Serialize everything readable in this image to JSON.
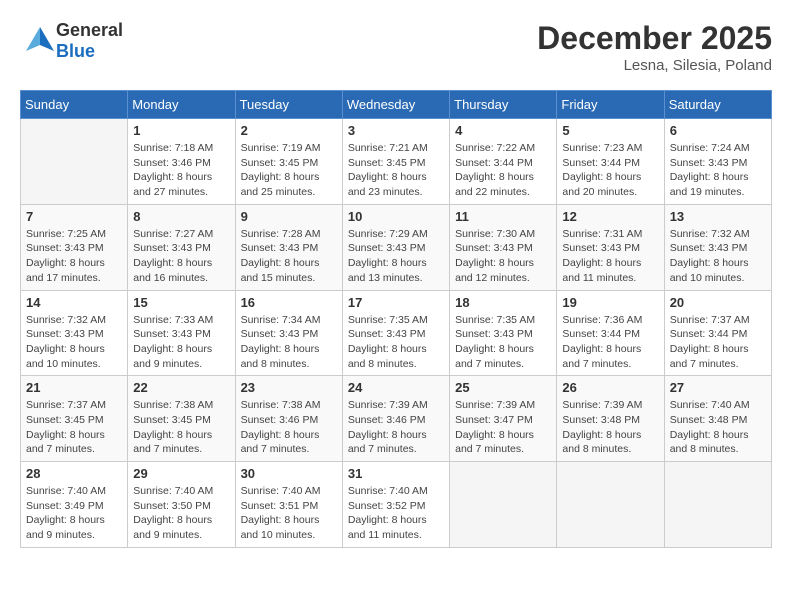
{
  "header": {
    "logo": {
      "text_general": "General",
      "text_blue": "Blue"
    },
    "month": "December 2025",
    "location": "Lesna, Silesia, Poland"
  },
  "days_of_week": [
    "Sunday",
    "Monday",
    "Tuesday",
    "Wednesday",
    "Thursday",
    "Friday",
    "Saturday"
  ],
  "weeks": [
    [
      {
        "day": "",
        "info": ""
      },
      {
        "day": "1",
        "info": "Sunrise: 7:18 AM\nSunset: 3:46 PM\nDaylight: 8 hours\nand 27 minutes."
      },
      {
        "day": "2",
        "info": "Sunrise: 7:19 AM\nSunset: 3:45 PM\nDaylight: 8 hours\nand 25 minutes."
      },
      {
        "day": "3",
        "info": "Sunrise: 7:21 AM\nSunset: 3:45 PM\nDaylight: 8 hours\nand 23 minutes."
      },
      {
        "day": "4",
        "info": "Sunrise: 7:22 AM\nSunset: 3:44 PM\nDaylight: 8 hours\nand 22 minutes."
      },
      {
        "day": "5",
        "info": "Sunrise: 7:23 AM\nSunset: 3:44 PM\nDaylight: 8 hours\nand 20 minutes."
      },
      {
        "day": "6",
        "info": "Sunrise: 7:24 AM\nSunset: 3:43 PM\nDaylight: 8 hours\nand 19 minutes."
      }
    ],
    [
      {
        "day": "7",
        "info": "Sunrise: 7:25 AM\nSunset: 3:43 PM\nDaylight: 8 hours\nand 17 minutes."
      },
      {
        "day": "8",
        "info": "Sunrise: 7:27 AM\nSunset: 3:43 PM\nDaylight: 8 hours\nand 16 minutes."
      },
      {
        "day": "9",
        "info": "Sunrise: 7:28 AM\nSunset: 3:43 PM\nDaylight: 8 hours\nand 15 minutes."
      },
      {
        "day": "10",
        "info": "Sunrise: 7:29 AM\nSunset: 3:43 PM\nDaylight: 8 hours\nand 13 minutes."
      },
      {
        "day": "11",
        "info": "Sunrise: 7:30 AM\nSunset: 3:43 PM\nDaylight: 8 hours\nand 12 minutes."
      },
      {
        "day": "12",
        "info": "Sunrise: 7:31 AM\nSunset: 3:43 PM\nDaylight: 8 hours\nand 11 minutes."
      },
      {
        "day": "13",
        "info": "Sunrise: 7:32 AM\nSunset: 3:43 PM\nDaylight: 8 hours\nand 10 minutes."
      }
    ],
    [
      {
        "day": "14",
        "info": "Sunrise: 7:32 AM\nSunset: 3:43 PM\nDaylight: 8 hours\nand 10 minutes."
      },
      {
        "day": "15",
        "info": "Sunrise: 7:33 AM\nSunset: 3:43 PM\nDaylight: 8 hours\nand 9 minutes."
      },
      {
        "day": "16",
        "info": "Sunrise: 7:34 AM\nSunset: 3:43 PM\nDaylight: 8 hours\nand 8 minutes."
      },
      {
        "day": "17",
        "info": "Sunrise: 7:35 AM\nSunset: 3:43 PM\nDaylight: 8 hours\nand 8 minutes."
      },
      {
        "day": "18",
        "info": "Sunrise: 7:35 AM\nSunset: 3:43 PM\nDaylight: 8 hours\nand 7 minutes."
      },
      {
        "day": "19",
        "info": "Sunrise: 7:36 AM\nSunset: 3:44 PM\nDaylight: 8 hours\nand 7 minutes."
      },
      {
        "day": "20",
        "info": "Sunrise: 7:37 AM\nSunset: 3:44 PM\nDaylight: 8 hours\nand 7 minutes."
      }
    ],
    [
      {
        "day": "21",
        "info": "Sunrise: 7:37 AM\nSunset: 3:45 PM\nDaylight: 8 hours\nand 7 minutes."
      },
      {
        "day": "22",
        "info": "Sunrise: 7:38 AM\nSunset: 3:45 PM\nDaylight: 8 hours\nand 7 minutes."
      },
      {
        "day": "23",
        "info": "Sunrise: 7:38 AM\nSunset: 3:46 PM\nDaylight: 8 hours\nand 7 minutes."
      },
      {
        "day": "24",
        "info": "Sunrise: 7:39 AM\nSunset: 3:46 PM\nDaylight: 8 hours\nand 7 minutes."
      },
      {
        "day": "25",
        "info": "Sunrise: 7:39 AM\nSunset: 3:47 PM\nDaylight: 8 hours\nand 7 minutes."
      },
      {
        "day": "26",
        "info": "Sunrise: 7:39 AM\nSunset: 3:48 PM\nDaylight: 8 hours\nand 8 minutes."
      },
      {
        "day": "27",
        "info": "Sunrise: 7:40 AM\nSunset: 3:48 PM\nDaylight: 8 hours\nand 8 minutes."
      }
    ],
    [
      {
        "day": "28",
        "info": "Sunrise: 7:40 AM\nSunset: 3:49 PM\nDaylight: 8 hours\nand 9 minutes."
      },
      {
        "day": "29",
        "info": "Sunrise: 7:40 AM\nSunset: 3:50 PM\nDaylight: 8 hours\nand 9 minutes."
      },
      {
        "day": "30",
        "info": "Sunrise: 7:40 AM\nSunset: 3:51 PM\nDaylight: 8 hours\nand 10 minutes."
      },
      {
        "day": "31",
        "info": "Sunrise: 7:40 AM\nSunset: 3:52 PM\nDaylight: 8 hours\nand 11 minutes."
      },
      {
        "day": "",
        "info": ""
      },
      {
        "day": "",
        "info": ""
      },
      {
        "day": "",
        "info": ""
      }
    ]
  ]
}
